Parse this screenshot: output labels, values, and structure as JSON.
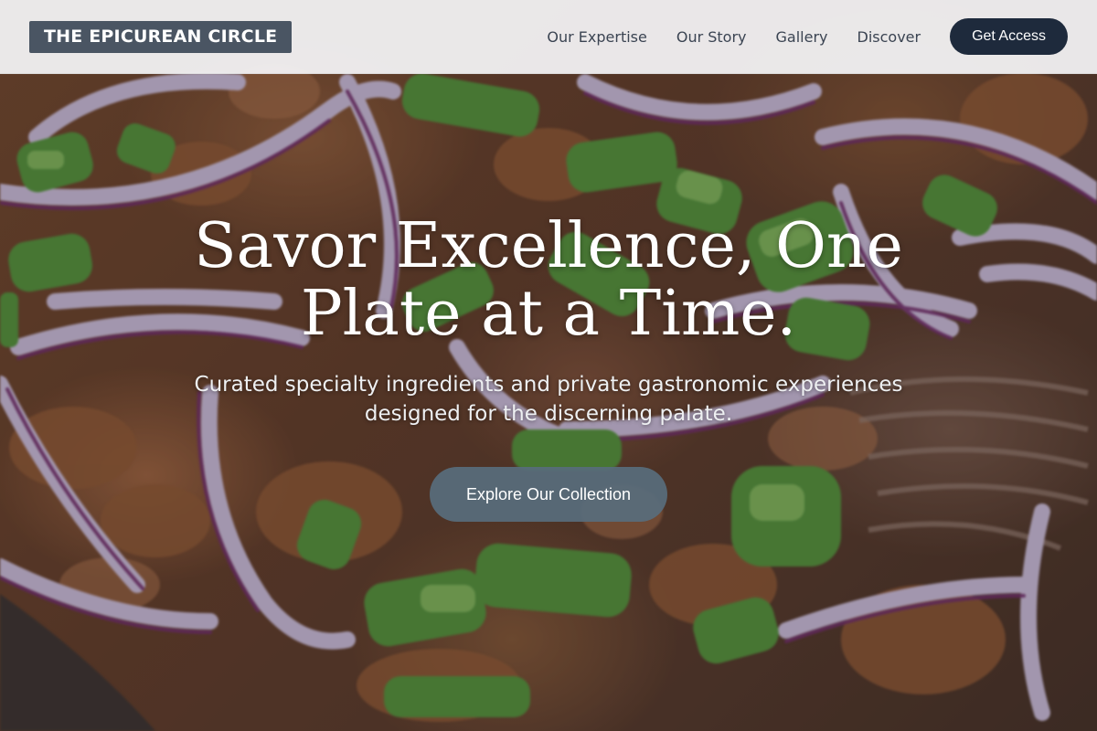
{
  "navbar": {
    "brand": "THE EPICUREAN CIRCLE",
    "links": [
      "Our Expertise",
      "Our Story",
      "Gallery",
      "Discover"
    ],
    "cta_label": "Get Access"
  },
  "hero": {
    "title": "Savor Excellence, One Plate at a Time.",
    "subtitle": "Curated specialty ingredients and private gastronomic experiences designed for the discerning palate.",
    "button_label": "Explore Our Collection"
  },
  "colors": {
    "brand_bg": "#4a5563",
    "cta_bg": "#1e2a3c",
    "hero_button_bg": "#586c7c",
    "nav_text": "#3b4452"
  }
}
